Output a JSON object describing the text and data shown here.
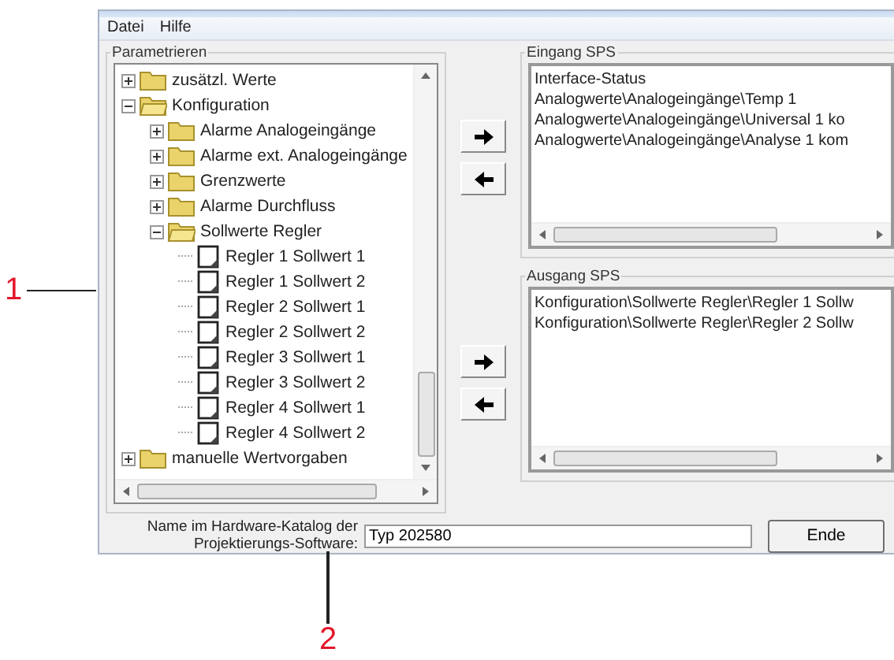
{
  "menu": [
    "Datei",
    "Hilfe"
  ],
  "parameter_group": {
    "title": "Parametrieren",
    "tree": [
      {
        "label": "zusätzl. Werte",
        "kind": "folder",
        "expanded": false
      },
      {
        "label": "Konfiguration",
        "kind": "folder",
        "expanded": true,
        "children": [
          {
            "label": "Alarme Analogeingänge",
            "kind": "folder",
            "expanded": false
          },
          {
            "label": "Alarme ext. Analogeingänge",
            "kind": "folder",
            "expanded": false
          },
          {
            "label": "Grenzwerte",
            "kind": "folder",
            "expanded": false
          },
          {
            "label": "Alarme Durchfluss",
            "kind": "folder",
            "expanded": false
          },
          {
            "label": "Sollwerte Regler",
            "kind": "folder",
            "expanded": true,
            "children": [
              {
                "label": "Regler 1 Sollwert 1",
                "kind": "item"
              },
              {
                "label": "Regler 1 Sollwert 2",
                "kind": "item"
              },
              {
                "label": "Regler 2 Sollwert 1",
                "kind": "item"
              },
              {
                "label": "Regler 2 Sollwert 2",
                "kind": "item"
              },
              {
                "label": "Regler 3 Sollwert 1",
                "kind": "item"
              },
              {
                "label": "Regler 3 Sollwert 2",
                "kind": "item"
              },
              {
                "label": "Regler 4 Sollwert 1",
                "kind": "item"
              },
              {
                "label": "Regler 4 Sollwert 2",
                "kind": "item"
              }
            ]
          }
        ]
      },
      {
        "label": "manuelle Wertvorgaben",
        "kind": "folder",
        "expanded": false
      }
    ]
  },
  "input_group": {
    "title": "Eingang SPS",
    "items": [
      "Interface-Status",
      "Analogwerte\\Analogeingänge\\Temp 1",
      "Analogwerte\\Analogeingänge\\Universal 1 ko",
      "Analogwerte\\Analogeingänge\\Analyse 1 kom"
    ]
  },
  "output_group": {
    "title": "Ausgang SPS",
    "items": [
      "Konfiguration\\Sollwerte Regler\\Regler 1 Sollw",
      "Konfiguration\\Sollwerte Regler\\Regler 2 Sollw"
    ]
  },
  "catalog_name": {
    "label_lines": [
      "Name im Hardware-Katalog der",
      "Projektierungs-Software:"
    ],
    "value": "Typ 202580"
  },
  "buttons": [
    "Ende"
  ],
  "callouts": [
    "1",
    "2"
  ]
}
